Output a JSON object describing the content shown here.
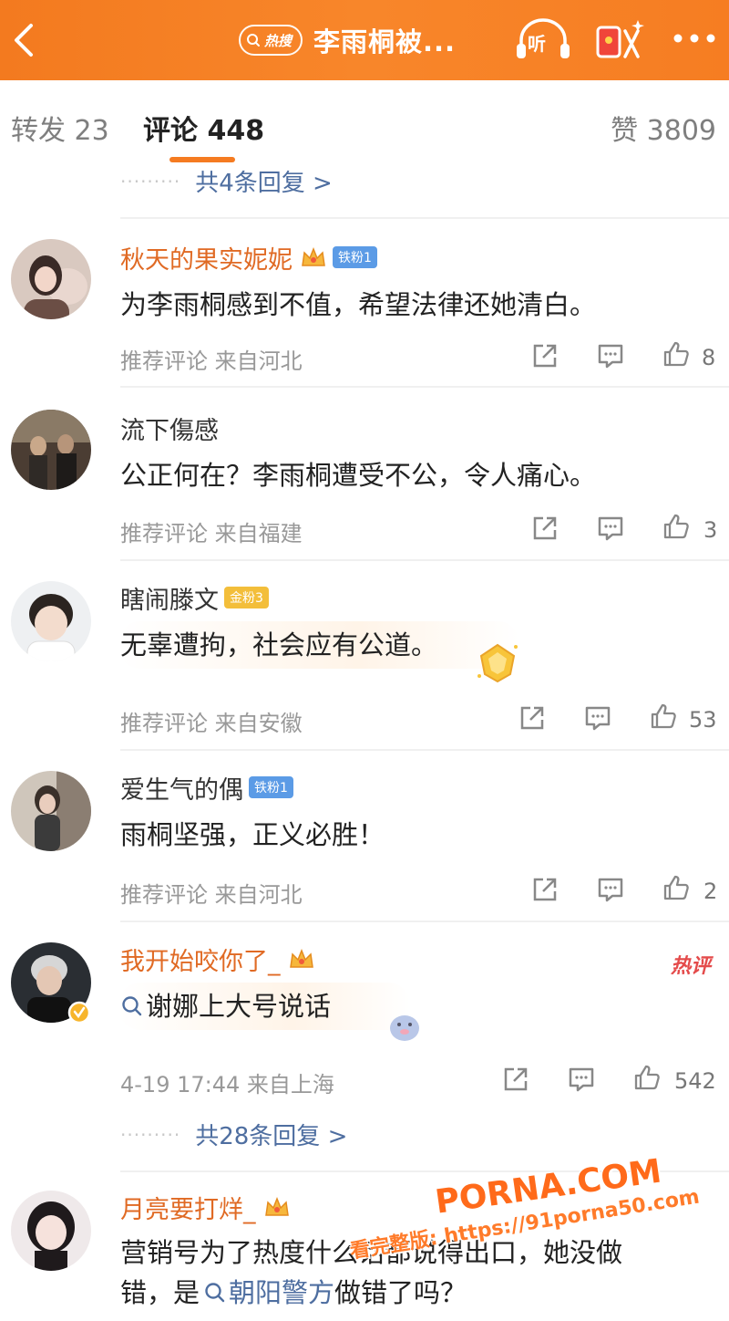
{
  "header": {
    "hot_badge": "热搜",
    "title": "李雨桐被...",
    "listen_label": "听"
  },
  "tabs": {
    "repost": "转发 23",
    "comment": "评论 448",
    "like": "赞 3809"
  },
  "top_replies": {
    "dots": "·········",
    "text": "共4条回复 >"
  },
  "comments": [
    {
      "name": "秋天的果实妮妮",
      "badge": "铁粉1",
      "text": "为李雨桐感到不值，希望法律还她清白。",
      "meta": "推荐评论  来自河北",
      "likes": "8"
    },
    {
      "name": "流下傷感",
      "text": "公正何在？李雨桐遭受不公，令人痛心。",
      "meta": "推荐评论  来自福建",
      "likes": "3"
    },
    {
      "name": "瞎闹滕文",
      "badge": "金粉3",
      "text": "无辜遭拘，社会应有公道。",
      "meta": "推荐评论  来自安徽",
      "likes": "53"
    },
    {
      "name": "爱生气的偶",
      "badge": "铁粉1",
      "text": "雨桐坚强，正义必胜！",
      "meta": "推荐评论  来自河北",
      "likes": "2"
    },
    {
      "name": "我开始咬你了_",
      "hot_tag": "热评",
      "search_text": "谢娜上大号说话",
      "meta": "4-19 17:44  来自上海",
      "likes": "542",
      "replies": "共28条回复 >"
    },
    {
      "name": "月亮要打烊_",
      "line1": "营销号为了热度什么话都说得出口，她没做",
      "line2_prefix": "错，是",
      "line2_search": "朝阳警方",
      "line2_suffix": "做错了吗？"
    }
  ],
  "watermark": {
    "brand": "PORNA.COM",
    "url": "看完整版: https://91porna50.com"
  },
  "colors": {
    "accent": "#f57b21",
    "link": "#4e6ea0",
    "vip_name": "#e06a24"
  }
}
